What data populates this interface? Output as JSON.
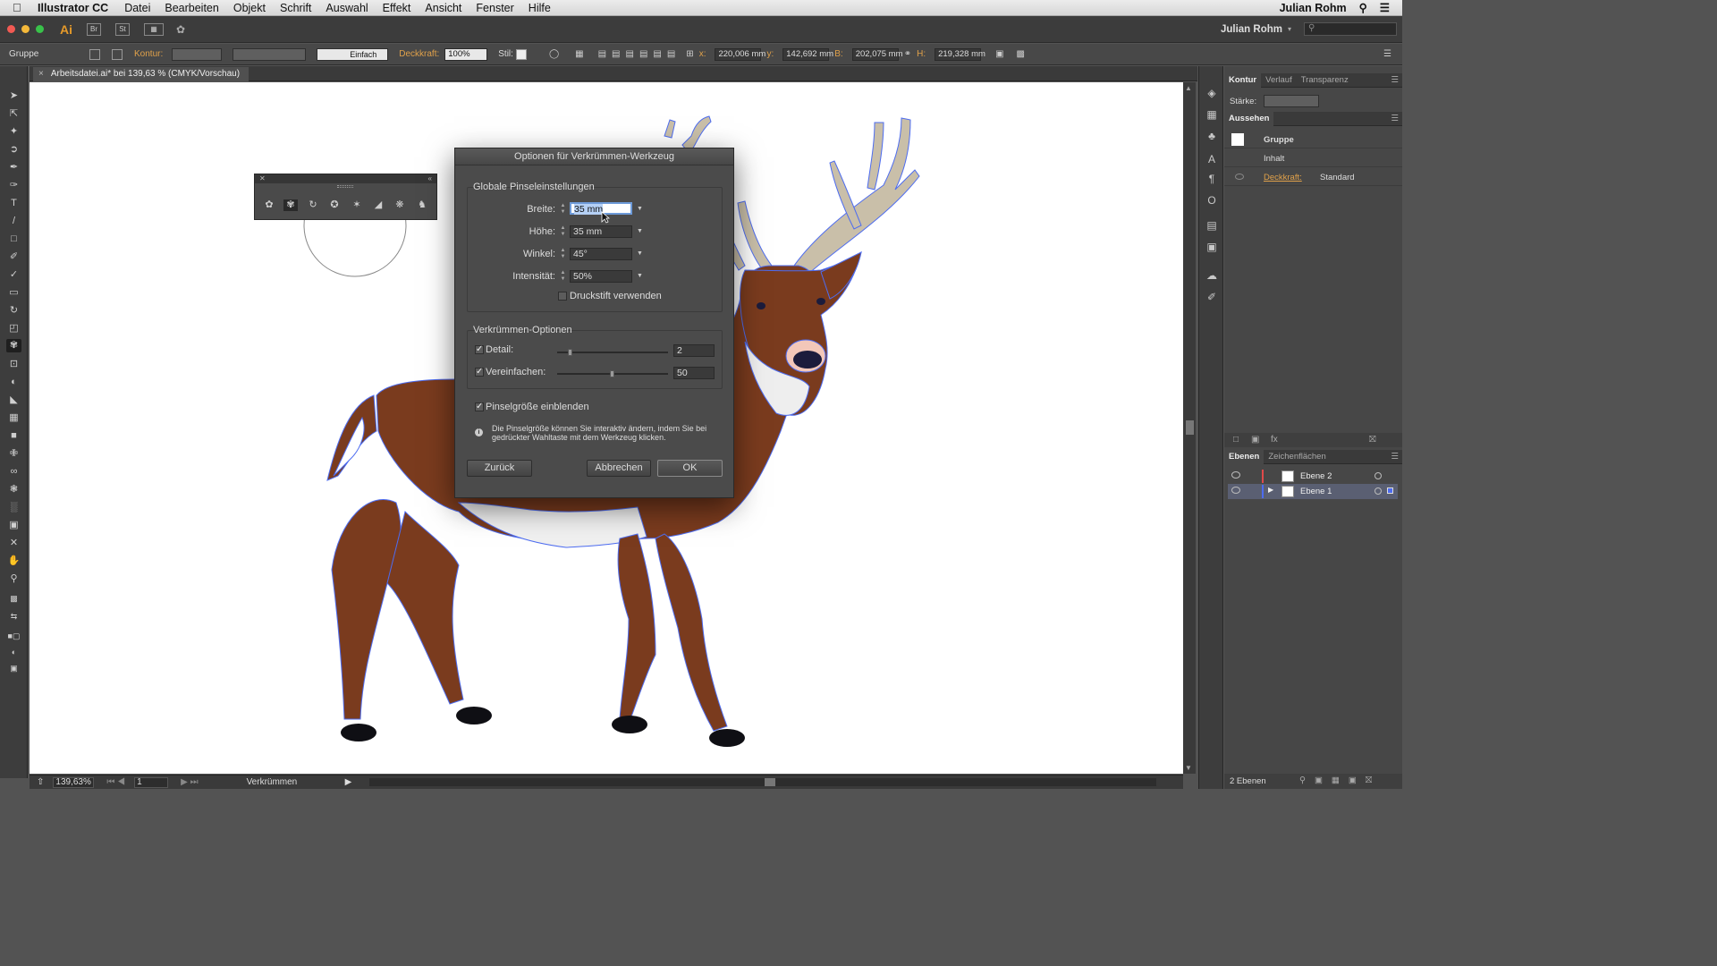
{
  "menubar": {
    "app_name": "Illustrator CC",
    "items": [
      "Datei",
      "Bearbeiten",
      "Objekt",
      "Schrift",
      "Auswahl",
      "Effekt",
      "Ansicht",
      "Fenster",
      "Hilfe"
    ],
    "user": "Julian Rohm"
  },
  "appbar": {
    "logo": "Ai",
    "bridge": "Br",
    "stock": "St",
    "workspace_user": "Julian Rohm"
  },
  "controlbar": {
    "selection": "Gruppe",
    "kontur_label": "Kontur:",
    "stroke_style": "Einfach",
    "opacity_label": "Deckkraft:",
    "opacity_value": "100%",
    "style_label": "Stil:",
    "x_label": "x:",
    "x_value": "220,006 mm",
    "y_label": "y:",
    "y_value": "142,692 mm",
    "w_label": "B:",
    "w_value": "202,075 mm",
    "h_label": "H:",
    "h_value": "219,328 mm"
  },
  "document": {
    "tab_title": "Arbeitsdatei.ai* bei 139,63 % (CMYK/Vorschau)",
    "close": "×"
  },
  "statusbar": {
    "zoom": "139,63%",
    "page": "1",
    "tool_name": "Verkrümmen"
  },
  "dialog": {
    "title": "Optionen für Verkrümmen-Werkzeug",
    "global_group": "Globale Pinseleinstellungen",
    "breite_label": "Breite:",
    "breite_value": "35 mm",
    "hoehe_label": "Höhe:",
    "hoehe_value": "35 mm",
    "winkel_label": "Winkel:",
    "winkel_value": "45°",
    "intensitaet_label": "Intensität:",
    "intensitaet_value": "50%",
    "druckstift_label": "Druckstift verwenden",
    "options_group": "Verkrümmen-Optionen",
    "detail_label": "Detail:",
    "detail_value": "2",
    "detail_level": 0.1,
    "vereinfachen_label": "Vereinfachen:",
    "vereinfachen_value": "50",
    "vereinfachen_level": 0.5,
    "pinsel_label": "Pinselgröße einblenden",
    "info_text": "Die Pinselgröße können Sie interaktiv ändern, indem Sie bei gedrückter Wahltaste mit dem Werkzeug klicken.",
    "reset_button": "Zurück",
    "cancel_button": "Abbrechen",
    "ok_button": "OK"
  },
  "panels": {
    "stroke_tabs": [
      "Kontur",
      "Verlauf",
      "Transparenz"
    ],
    "staerke_label": "Stärke:",
    "aussehen_tab": "Aussehen",
    "appearance_rows": [
      "Gruppe",
      "Inhalt",
      "Deckkraft:",
      "Standard"
    ],
    "layer_tabs": [
      "Ebenen",
      "Zeichenflächen"
    ],
    "layers": [
      "Ebene 2",
      "Ebene 1"
    ],
    "layer_count": "2 Ebenen"
  },
  "icons": {
    "tools": [
      "selection-icon",
      "direct-selection-icon",
      "magic-wand-icon",
      "lasso-icon",
      "pen-icon",
      "curvature-icon",
      "type-icon",
      "line-icon",
      "rectangle-icon",
      "paintbrush-icon",
      "blob-brush-icon",
      "eraser-icon",
      "rotate-icon",
      "scale-icon",
      "warp-icon",
      "free-transform-icon",
      "shape-builder-icon",
      "perspective-icon",
      "mesh-icon",
      "gradient-icon",
      "eyedropper-icon",
      "blend-icon",
      "symbol-sprayer-icon",
      "graph-icon",
      "artboard-icon",
      "slice-icon",
      "hand-icon",
      "zoom-icon"
    ]
  },
  "colors": {
    "deer_body": "#7a3b1e",
    "deer_antler": "#c9bfa9",
    "selection": "#4d6cf0",
    "accent_orange": "#e0a14a"
  }
}
